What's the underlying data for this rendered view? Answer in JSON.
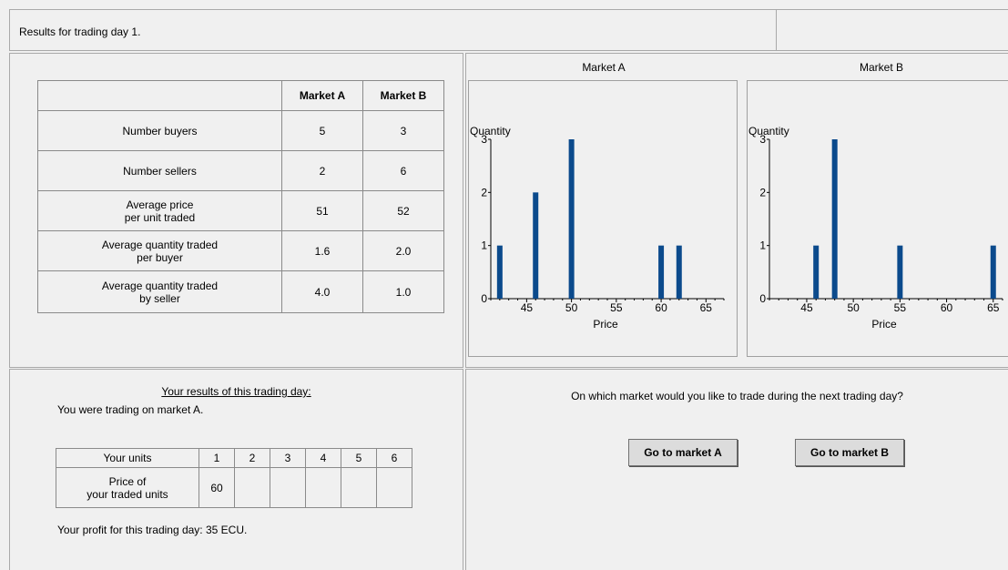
{
  "header": {
    "text": "Results for trading day 1."
  },
  "summary": {
    "columns": [
      "Market A",
      "Market B"
    ],
    "rows": [
      {
        "label": [
          "Number buyers"
        ],
        "a": "5",
        "b": "3"
      },
      {
        "label": [
          "Number sellers"
        ],
        "a": "2",
        "b": "6"
      },
      {
        "label": [
          "Average price",
          "per unit traded"
        ],
        "a": "51",
        "b": "52"
      },
      {
        "label": [
          "Average quantity traded",
          "per buyer"
        ],
        "a": "1.6",
        "b": "2.0"
      },
      {
        "label": [
          "Average quantity traded",
          "by seller"
        ],
        "a": "4.0",
        "b": "1.0"
      }
    ]
  },
  "chart_data": [
    {
      "type": "bar",
      "title": "Market A",
      "xlabel": "Price",
      "ylabel": "Quantity",
      "x": [
        42,
        46,
        50,
        60,
        62
      ],
      "values": [
        1,
        2,
        3,
        1,
        1
      ],
      "xlim": [
        41,
        67
      ],
      "ylim": [
        0,
        3
      ],
      "xticks": [
        45,
        50,
        55,
        60,
        65
      ],
      "yticks": [
        0,
        1,
        2,
        3
      ],
      "color": "#0b4a8c",
      "grid": false
    },
    {
      "type": "bar",
      "title": "Market B",
      "xlabel": "Price",
      "ylabel": "Quantity",
      "x": [
        46,
        48,
        55,
        65
      ],
      "values": [
        1,
        3,
        1,
        1
      ],
      "xlim": [
        41,
        66
      ],
      "ylim": [
        0,
        3
      ],
      "xticks": [
        45,
        50,
        55,
        60,
        65
      ],
      "yticks": [
        0,
        1,
        2,
        3
      ],
      "color": "#0b4a8c",
      "grid": false
    }
  ],
  "results": {
    "title": "Your results of this trading day:",
    "market_text": "You were trading on market A.",
    "units_header_label": "Your units",
    "unit_numbers": [
      "1",
      "2",
      "3",
      "4",
      "5",
      "6"
    ],
    "price_label": [
      "Price of",
      "your traded units"
    ],
    "prices": [
      "60",
      "",
      "",
      "",
      "",
      ""
    ],
    "profit_text": "Your profit for this trading day: 35 ECU."
  },
  "choice": {
    "question": "On which market would you like to trade during the next trading day?",
    "button_a": "Go to market A",
    "button_b": "Go to market B"
  }
}
